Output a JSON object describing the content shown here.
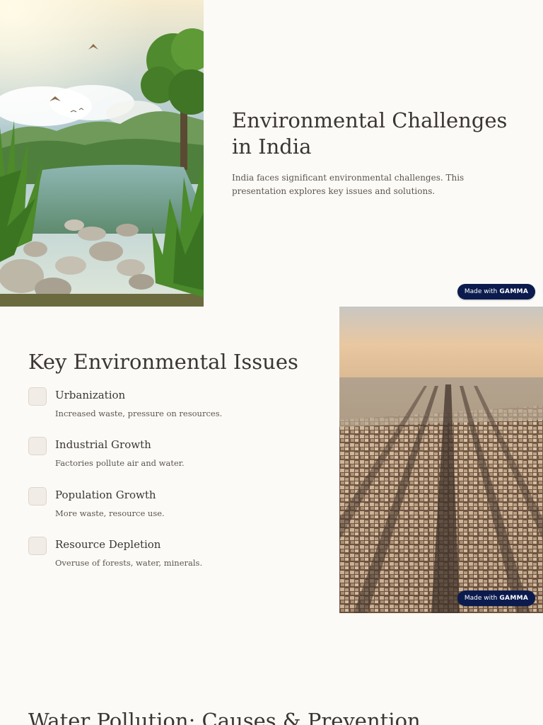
{
  "slide1": {
    "title": "Environmental Challenges in India",
    "subtitle": "India faces significant environmental challenges. This presentation explores key issues and solutions."
  },
  "badge": {
    "prefix": "Made with",
    "brand": "GAMMA"
  },
  "slide2": {
    "title": "Key Environmental Issues",
    "issues": [
      {
        "title": "Urbanization",
        "desc": "Increased waste, pressure on resources."
      },
      {
        "title": "Industrial Growth",
        "desc": "Factories pollute air and water."
      },
      {
        "title": "Population Growth",
        "desc": "More waste, resource use."
      },
      {
        "title": "Resource Depletion",
        "desc": "Overuse of forests, water, minerals."
      }
    ]
  },
  "slide3": {
    "title": "Water Pollution: Causes & Prevention"
  }
}
